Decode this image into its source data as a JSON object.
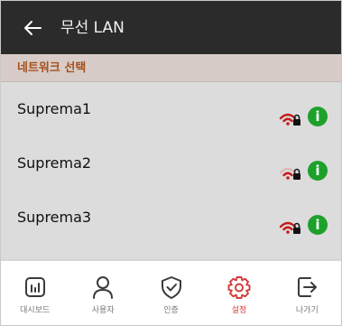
{
  "header": {
    "title": "무선 LAN"
  },
  "section": {
    "title": "네트워크 선택"
  },
  "networks": [
    {
      "name": "Suprema1",
      "secured": true,
      "info_glyph": "i"
    },
    {
      "name": "Suprema2",
      "secured": true,
      "info_glyph": "i"
    },
    {
      "name": "Suprema3",
      "secured": true,
      "info_glyph": "i"
    }
  ],
  "nav": {
    "items": [
      {
        "label": "대시보드",
        "icon": "dashboard-icon"
      },
      {
        "label": "사용자",
        "icon": "user-icon"
      },
      {
        "label": "인증",
        "icon": "shield-check-icon"
      },
      {
        "label": "설정",
        "icon": "gear-icon",
        "active": true
      },
      {
        "label": "나가기",
        "icon": "exit-icon"
      }
    ]
  },
  "colors": {
    "header_bg": "#2b2b2b",
    "section_bg": "#d7ccc7",
    "section_text": "#a4501d",
    "accent": "#d53a3a",
    "info": "#1ea12b",
    "list_bg": "#dcdcdc"
  }
}
